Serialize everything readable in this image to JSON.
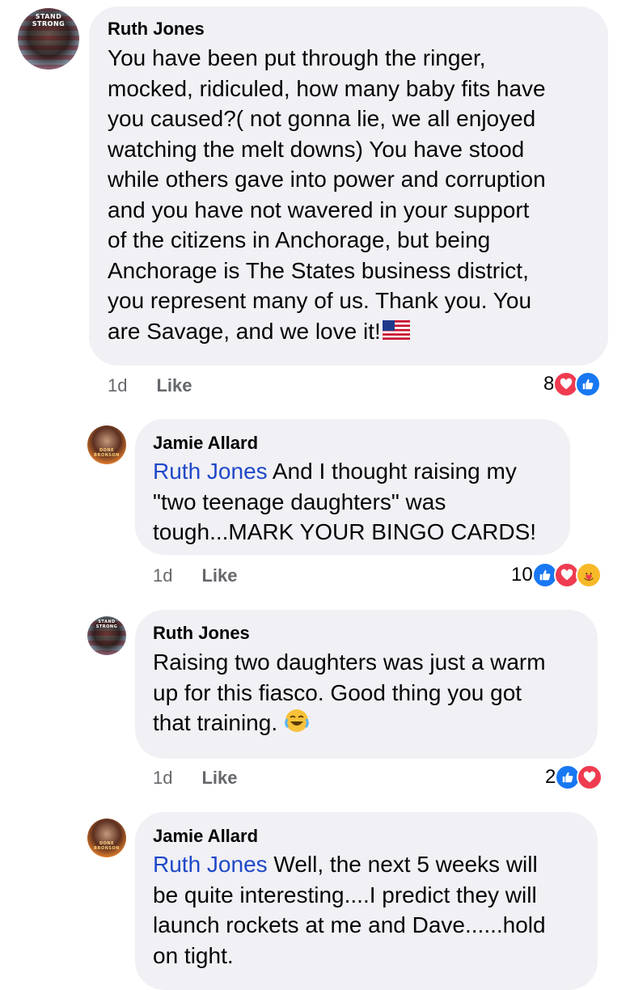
{
  "comments": [
    {
      "author": "Ruth Jones",
      "avatar_text": "STAND STRONG",
      "mention": "",
      "text": "You have been put through the ringer,\nmocked, ridiculed, how many baby fits have\nyou caused?( not gonna lie, we all enjoyed\nwatching the melt downs)  You have stood\nwhile others gave into power and corruption\nand you have not wavered in your support\nof the citizens in Anchorage, but being\nAnchorage is The States business district,\nyou represent many of us. Thank you. You\nare Savage, and we love it!",
      "time": "1d",
      "like_label": "Like",
      "reaction_count": "8",
      "reactions": [
        "love",
        "like"
      ]
    },
    {
      "author": "Jamie Allard",
      "avatar_text": "DONE BRONSON",
      "mention": "Ruth Jones",
      "text": " And I thought raising my\n\"two teenage daughters\" was\ntough...MARK YOUR BINGO CARDS!",
      "time": "1d",
      "like_label": "Like",
      "reaction_count": "10",
      "reactions": [
        "like",
        "love",
        "care"
      ]
    },
    {
      "author": "Ruth Jones",
      "avatar_text": "STAND STRONG",
      "mention": "",
      "text": "Raising two daughters was just a warm\nup for this fiasco.  Good thing you got\nthat training.",
      "time": "1d",
      "like_label": "Like",
      "reaction_count": "2",
      "reactions": [
        "like",
        "love"
      ]
    },
    {
      "author": "Jamie Allard",
      "avatar_text": "DONE BRONSON",
      "mention": "Ruth Jones",
      "text": " Well, the next 5 weeks will\nbe quite interesting....I predict they will\nlaunch rockets at me and Dave......hold\non tight."
    }
  ],
  "colors": {
    "bubble": "#f0f0f5",
    "mention": "#1f48c8",
    "meta": "#65676b",
    "love": "#ef3b4f",
    "like": "#1877f2",
    "care": "#f7b928"
  }
}
